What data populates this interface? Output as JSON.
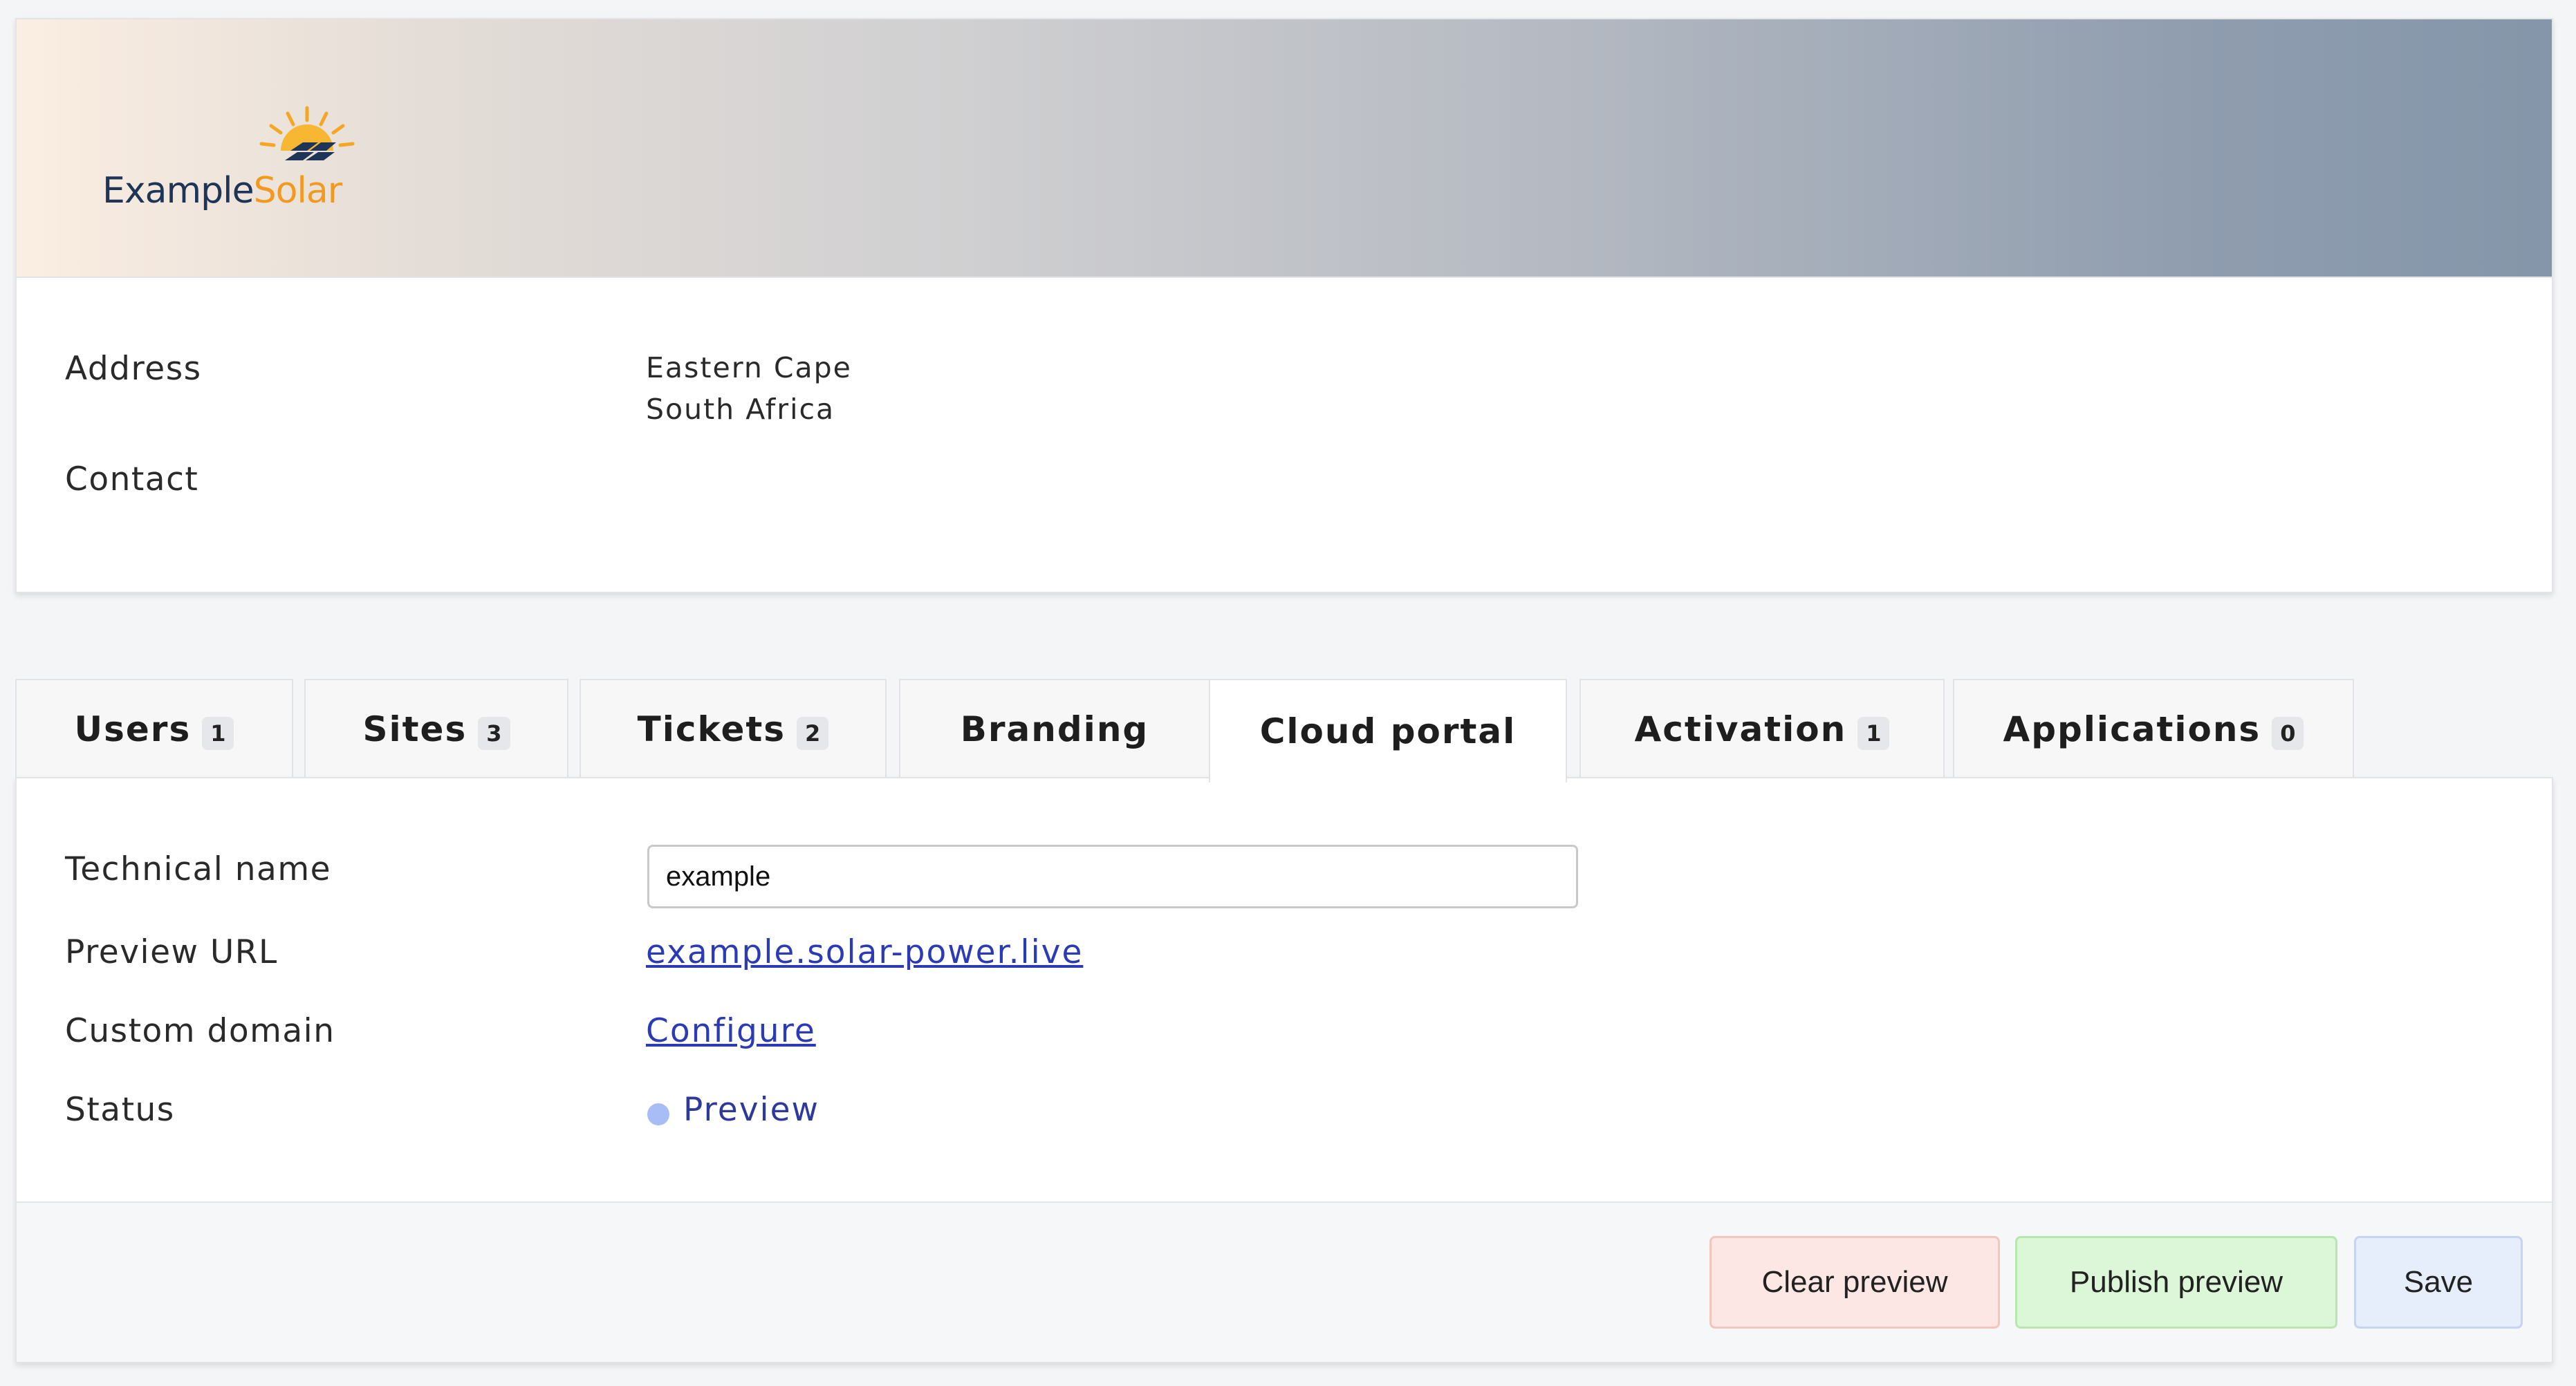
{
  "brand": {
    "name_part1": "Example",
    "name_part2": "Solar",
    "primary_color": "#1f3558",
    "accent_color": "#f19a1f"
  },
  "profile": {
    "address_label": "Address",
    "address_line1": "Eastern Cape",
    "address_line2": "South Africa",
    "contact_label": "Contact"
  },
  "tabs": [
    {
      "label": "Users",
      "badge": "1"
    },
    {
      "label": "Sites",
      "badge": "3"
    },
    {
      "label": "Tickets",
      "badge": "2"
    },
    {
      "label": "Branding",
      "badge": ""
    },
    {
      "label": "Cloud portal",
      "badge": "",
      "active": true
    },
    {
      "label": "Activation",
      "badge": "1"
    },
    {
      "label": "Applications",
      "badge": "0"
    }
  ],
  "portal": {
    "technical_name_label": "Technical name",
    "technical_name_value": "example",
    "preview_url_label": "Preview URL",
    "preview_url_value": "example.solar-power.live",
    "custom_domain_label": "Custom domain",
    "custom_domain_value": "Configure",
    "status_label": "Status",
    "status_value": "Preview",
    "status_color": "#a8bdf5"
  },
  "actions": {
    "clear_label": "Clear preview",
    "publish_label": "Publish preview",
    "save_label": "Save"
  }
}
